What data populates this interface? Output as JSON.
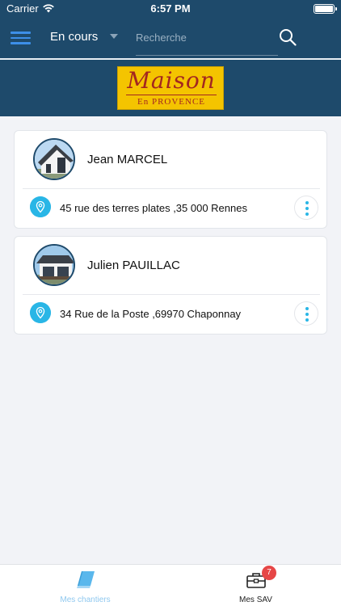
{
  "status_bar": {
    "carrier": "Carrier",
    "time": "6:57 PM"
  },
  "top_bar": {
    "filter_label": "En cours",
    "search_placeholder": "Recherche"
  },
  "logo": {
    "main": "Maison",
    "sub": "En PROVENCE"
  },
  "projects": [
    {
      "name": "Jean MARCEL",
      "address": "45 rue des terres plates ,35 000 Rennes"
    },
    {
      "name": "Julien PAUILLAC",
      "address": "34 Rue de la Poste ,69970 Chaponnay"
    }
  ],
  "tab_bar": {
    "tabs": [
      {
        "label": "Mes chantiers",
        "icon": "book-icon",
        "active": true
      },
      {
        "label": "Mes SAV",
        "icon": "toolbox-icon",
        "badge": "7"
      }
    ]
  },
  "colors": {
    "header": "#1e4a6b",
    "accent": "#29b6e6",
    "menu": "#3d8fe8",
    "badge": "#e64646",
    "logo_bg": "#f4c400",
    "logo_text": "#a32620"
  }
}
